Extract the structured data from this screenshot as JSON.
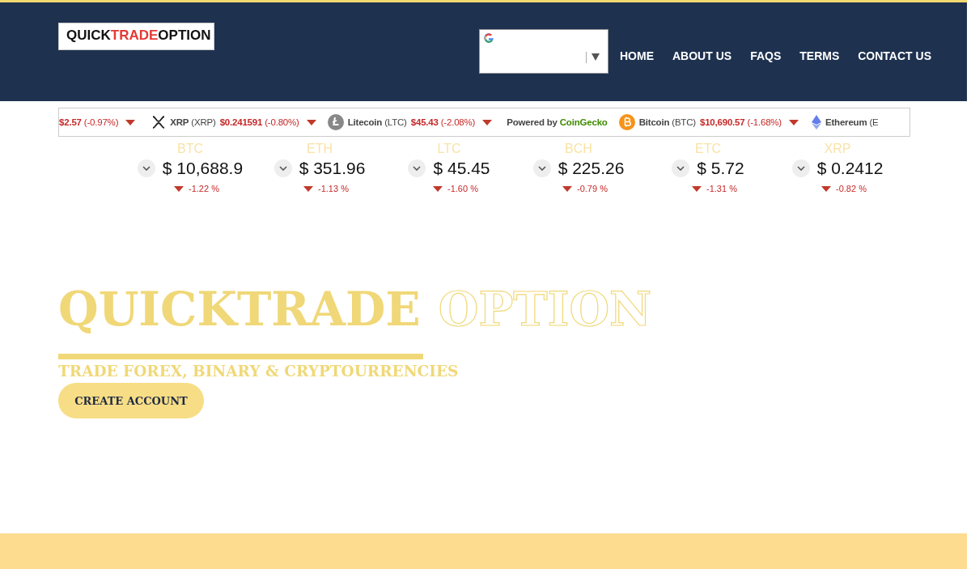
{
  "header": {
    "logo": [
      {
        "text": "QUICK",
        "accent": false
      },
      {
        "text": "TRADE",
        "accent": true
      },
      {
        "text": "OPTION",
        "accent": false
      }
    ],
    "nav": [
      {
        "label": "HOME"
      },
      {
        "label": "ABOUT US"
      },
      {
        "label": "FAQS"
      },
      {
        "label": "TERMS"
      },
      {
        "label": "CONTACT US"
      }
    ]
  },
  "ticker": [
    {
      "kind": "price",
      "price": "$2.57",
      "change": "(-0.97%)",
      "falling": true
    },
    {
      "kind": "coin",
      "name": "XRP",
      "symbol": "(XRP)",
      "price": "$0.241591",
      "change": "(-0.80%)",
      "falling": true
    },
    {
      "kind": "coin",
      "name": "Litecoin",
      "symbol": "(LTC)",
      "price": "$45.43",
      "change": "(-2.08%)",
      "falling": true
    },
    {
      "kind": "credit",
      "label": "Powered by",
      "brand": "CoinGecko"
    },
    {
      "kind": "coin",
      "name": "Bitcoin",
      "symbol": "(BTC)",
      "price": "$10,690.57",
      "change": "(-1.68%)",
      "falling": true
    },
    {
      "kind": "coin",
      "name": "Ethereum",
      "symbol": "(E"
    }
  ],
  "prices": [
    {
      "symbol": "BTC",
      "price": "$ 10,688.9",
      "change": "-1.22 %",
      "falling": true
    },
    {
      "symbol": "ETH",
      "price": "$ 351.96",
      "change": "-1.13 %",
      "falling": true
    },
    {
      "symbol": "LTC",
      "price": "$ 45.45",
      "change": "-1.60 %",
      "falling": true
    },
    {
      "symbol": "BCH",
      "price": "$ 225.26",
      "change": "-0.79 %",
      "falling": true
    },
    {
      "symbol": "ETC",
      "price": "$ 5.72",
      "change": "-1.31 %",
      "falling": true
    },
    {
      "symbol": "XRP",
      "price": "$ 0.2412",
      "change": "-0.82 %",
      "falling": true
    }
  ],
  "hero": {
    "title": "QUICKTRADE",
    "title_outline": "OPTION",
    "subtitle": "TRADE FOREX, BINARY & CRYPTOURRENCIES",
    "button": "CREATE ACCOUNT"
  }
}
